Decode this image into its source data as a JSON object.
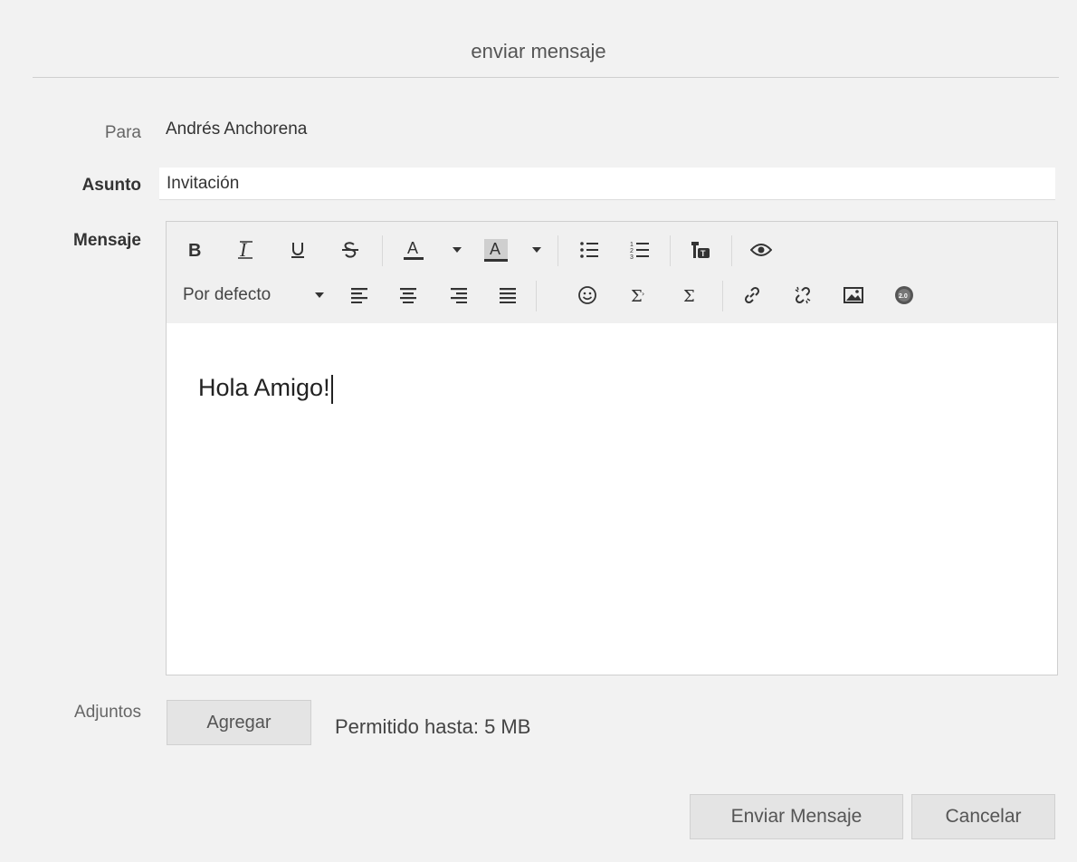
{
  "dialog": {
    "title": "enviar mensaje"
  },
  "form": {
    "to_label": "Para",
    "to_value": "Andrés Anchorena",
    "subject_label": "Asunto",
    "subject_value": "Invitación",
    "message_label": "Mensaje",
    "attachments_label": "Adjuntos"
  },
  "editor": {
    "font_select": "Por defecto",
    "content": "Hola Amigo!",
    "toolbar_icons": [
      "bold-icon",
      "italic-icon",
      "underline-icon",
      "strikethrough-icon",
      "text-color-icon",
      "background-color-icon",
      "bullet-list-icon",
      "numbered-list-icon",
      "translate-icon",
      "preview-icon",
      "align-left-icon",
      "align-center-icon",
      "align-right-icon",
      "align-justify-icon",
      "emoji-icon",
      "formula-icon",
      "sum-icon",
      "link-icon",
      "unlink-icon",
      "image-icon",
      "badge-2-0-icon"
    ]
  },
  "attachments": {
    "add_button": "Agregar",
    "limit_text": "Permitido hasta: 5 MB"
  },
  "actions": {
    "send_button": "Enviar Mensaje",
    "cancel_button": "Cancelar"
  }
}
